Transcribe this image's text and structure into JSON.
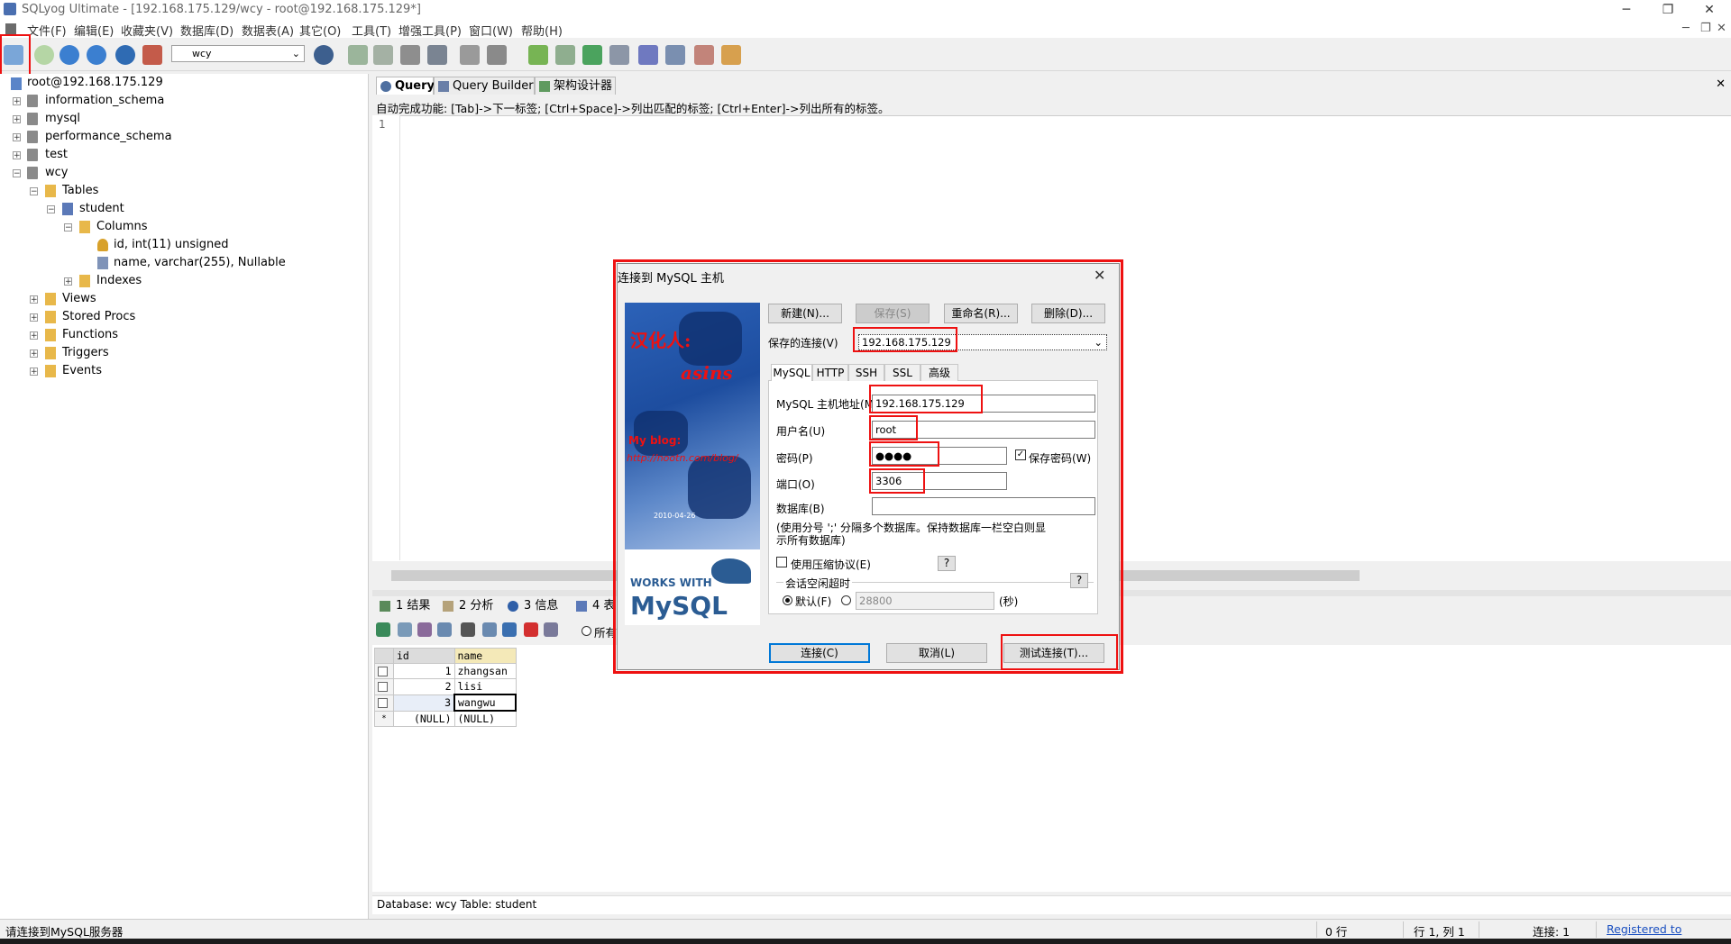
{
  "window": {
    "title": "SQLyog Ultimate - [192.168.175.129/wcy - root@192.168.175.129*]",
    "min": "─",
    "max": "❐",
    "close": "✕"
  },
  "menu": [
    "文件(F)",
    "编辑(E)",
    "收藏夹(V)",
    "数据库(D)",
    "数据表(A)",
    "其它(O)",
    "工具(T)",
    "增强工具(P)",
    "窗口(W)",
    "帮助(H)"
  ],
  "toolbar": {
    "db_selected": "wcy"
  },
  "tree": {
    "root": "root@192.168.175.129",
    "databases": [
      "information_schema",
      "mysql",
      "performance_schema",
      "test",
      "wcy"
    ],
    "tables_label": "Tables",
    "table": "student",
    "columns_label": "Columns",
    "columns": [
      "id, int(11) unsigned",
      "name, varchar(255), Nullable"
    ],
    "indexes_label": "Indexes",
    "others": [
      "Views",
      "Stored Procs",
      "Functions",
      "Triggers",
      "Events"
    ]
  },
  "tabs": [
    "Query",
    "Query Builder",
    "架构设计器"
  ],
  "hint": "自动完成功能: [Tab]->下一标签; [Ctrl+Space]->列出匹配的标签; [Ctrl+Enter]->列出所有的标签。",
  "editor": {
    "line": "1"
  },
  "result_tabs": [
    "1 结果",
    "2 分析",
    "3 信息",
    "4 表"
  ],
  "result_toolbar": {
    "radio_label": "所有"
  },
  "grid": {
    "headers": [
      "id",
      "name"
    ],
    "rows": [
      [
        "1",
        "zhangsan"
      ],
      [
        "2",
        "lisi"
      ],
      [
        "3",
        "wangwu"
      ],
      [
        "(NULL)",
        "(NULL)"
      ]
    ]
  },
  "db_info": "Database: wcy  Table: student",
  "statusbar": {
    "left": "请连接到MySQL服务器",
    "rows": "0 行",
    "pos": "行 1, 列 1",
    "conn": "连接: 1",
    "reg": "Registered to"
  },
  "dialog": {
    "title": "连接到 MySQL 主机",
    "buttons": {
      "new": "新建(N)...",
      "save": "保存(S)",
      "rename": "重命名(R)...",
      "delete": "删除(D)..."
    },
    "saved_label": "保存的连接(V)",
    "saved_value": "192.168.175.129",
    "tabs": [
      "MySQL",
      "HTTP",
      "SSH",
      "SSL",
      "高级"
    ],
    "host_label": "MySQL 主机地址(M)",
    "host_value": "192.168.175.129",
    "user_label": "用户名(U)",
    "user_value": "root",
    "pwd_label": "密码(P)",
    "pwd_value": "●●●●",
    "save_pwd": "保存密码(W)",
    "port_label": "端口(O)",
    "port_value": "3306",
    "db_label": "数据库(B)",
    "db_note": "(使用分号 ';' 分隔多个数据库。保持数据库一栏空白则显示所有数据库)",
    "compress": "使用压缩协议(E)",
    "help": "?",
    "timeout_label": "会话空闲超时",
    "default_label": "默认(F)",
    "timeout_value": "28800",
    "sec": "(秒)",
    "connect": "连接(C)",
    "cancel": "取消(L)",
    "test": "测试连接(T)...",
    "banner": {
      "credit": "汉化人:",
      "name": "asins",
      "blog": "My blog:",
      "url": "http://nootn.com/blog/",
      "date": "2010-04-26",
      "works": "WORKS WITH",
      "mysql": "MySQL"
    }
  },
  "colors": {
    "highlight": "#e11111",
    "accent": "#0078d7"
  }
}
